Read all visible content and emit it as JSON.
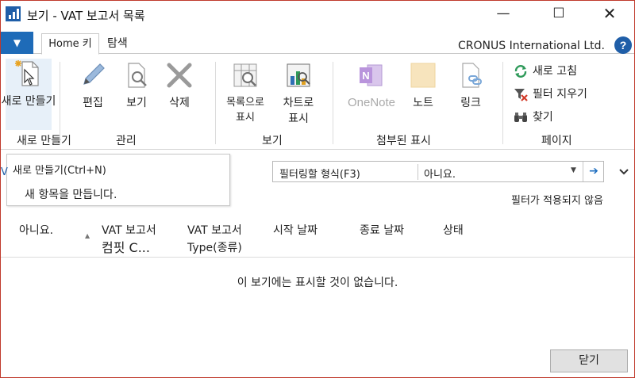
{
  "window": {
    "title": "보기 - VAT 보고서 목록",
    "minimize": "—",
    "maximize": "☐",
    "close": "✕"
  },
  "tabs": {
    "app_menu": "▼",
    "home": "Home 키",
    "search": "탐색"
  },
  "company": "CRONUS International Ltd.",
  "help": "?",
  "ribbon": {
    "new_group": {
      "new_label": "새로 만들기",
      "group_label": "새로 만들기"
    },
    "manage_group": {
      "edit": "편집",
      "view": "보기",
      "delete": "삭제",
      "group_label": "관리"
    },
    "view_group": {
      "show_list_1": "목록으로",
      "show_list_2": "표시",
      "show_chart_1": "차트로",
      "show_chart_2": "표시",
      "group_label": "보기"
    },
    "attach_group": {
      "onenote": "OneNote",
      "note": "노트",
      "link": "링크",
      "group_label": "첨부된 표시"
    },
    "page_group": {
      "refresh": "새로 고침",
      "clear_filter": "필터 지우기",
      "find": "찾기",
      "group_label": "페이지"
    }
  },
  "tooltip": {
    "title": "새로 만들기(Ctrl+N)",
    "description": "새 항목을 만듭니다."
  },
  "filter": {
    "label": "필터링할 형식(F3)",
    "value": "아니요.",
    "status": "필터가 적용되지 않음"
  },
  "left_sliver": "V",
  "table": {
    "columns": [
      {
        "line1": "아니요.",
        "line2": ""
      },
      {
        "line1": "VAT 보고서",
        "line2": "컴핏 C..."
      },
      {
        "line1": "VAT 보고서",
        "line2": "Type(종류)"
      },
      {
        "line1": "시작 날짜",
        "line2": ""
      },
      {
        "line1": "종료 날짜",
        "line2": ""
      },
      {
        "line1": "상태",
        "line2": ""
      }
    ],
    "empty_message": "이 보기에는 표시할 것이 없습니다."
  },
  "close_button": "닫기",
  "colors": {
    "accent": "#1e6bb8",
    "onenote": "#7b4fb0",
    "close_border": "#c0392b"
  }
}
